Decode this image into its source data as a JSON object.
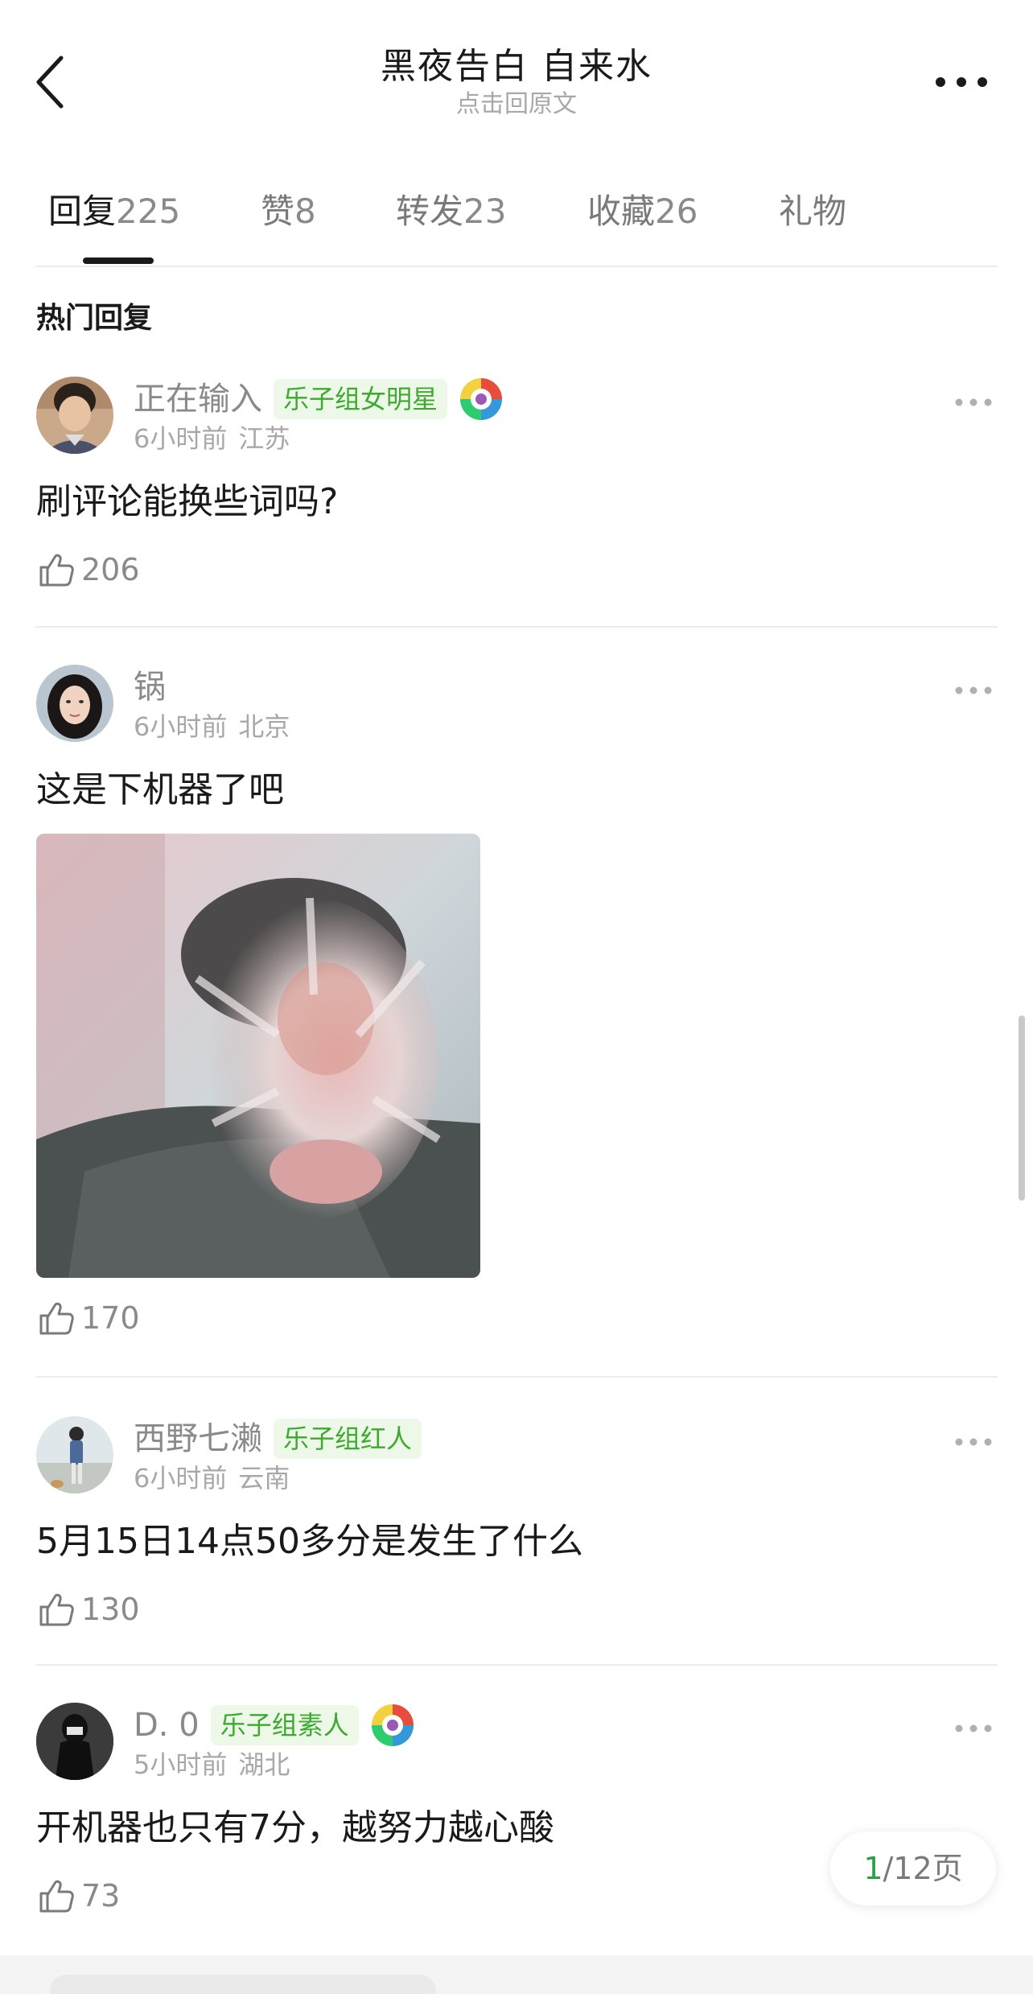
{
  "header": {
    "title": "黑夜告白 自来水",
    "subtitle": "点击回原文"
  },
  "tabs": [
    {
      "label": "回复",
      "count": "225",
      "active": true
    },
    {
      "label": "赞",
      "count": "8"
    },
    {
      "label": "转发",
      "count": "23"
    },
    {
      "label": "收藏",
      "count": "26"
    },
    {
      "label": "礼物",
      "count": ""
    }
  ],
  "section_title": "热门回复",
  "comments": [
    {
      "username": "正在输入",
      "badge": "乐子组女明星",
      "has_medal": true,
      "time": "6小时前",
      "location": "江苏",
      "text": "刷评论能换些词吗?",
      "likes": "206"
    },
    {
      "username": "锅",
      "badge": "",
      "has_medal": false,
      "time": "6小时前",
      "location": "北京",
      "text": "这是下机器了吧",
      "has_image": true,
      "likes": "170"
    },
    {
      "username": "西野七濑",
      "badge": "乐子组红人",
      "has_medal": false,
      "time": "6小时前",
      "location": "云南",
      "text": "5月15日14点50多分是发生了什么",
      "likes": "130"
    },
    {
      "username": "D. 0",
      "badge": "乐子组素人",
      "has_medal": true,
      "time": "5小时前",
      "location": "湖北",
      "text": "开机器也只有7分，越努力越心酸",
      "likes": "73"
    }
  ],
  "pagination": {
    "current": "1",
    "total": "/12页"
  },
  "colors": {
    "accent_green": "#3daa2f",
    "badge_bg": "#eef8e8",
    "page_green": "#2ea043"
  },
  "icons": [
    "back-arrow-icon",
    "more-dots-icon",
    "thumbs-up-icon",
    "medal-icon"
  ]
}
